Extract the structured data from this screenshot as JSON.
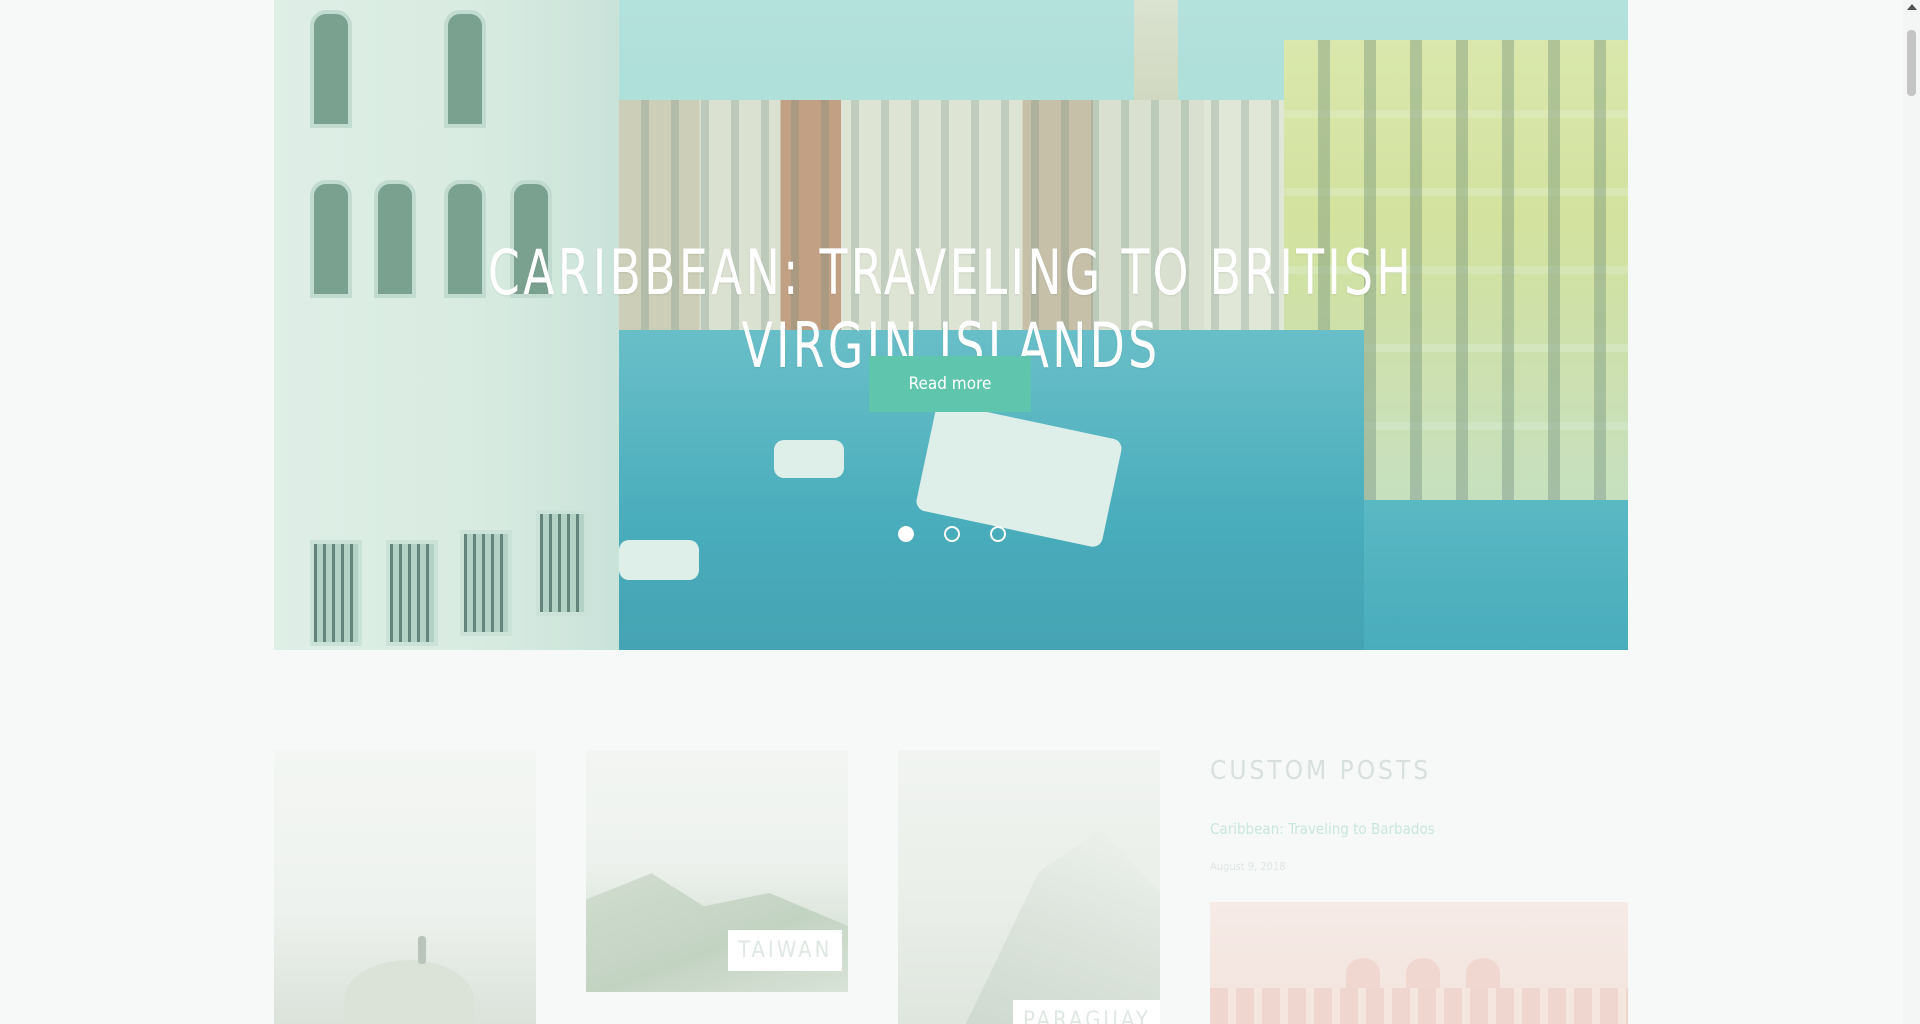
{
  "hero": {
    "title": "CARIBBEAN: TRAVELING TO BRITISH VIRGIN ISLANDS",
    "button_label": "Read more",
    "slides": 3,
    "active_slide": 1
  },
  "cards": [
    {
      "label": ""
    },
    {
      "label": "TAIWAN"
    },
    {
      "label": "PARAGUAY"
    }
  ],
  "sidebar": {
    "title": "CUSTOM POSTS",
    "post": {
      "title": "Caribbean: Traveling to Barbados",
      "date": "August 9, 2018"
    }
  },
  "colors": {
    "accent": "#5fc5ad",
    "hero_text": "#ffffff",
    "background": "#f7f9f8"
  },
  "icons": [
    "scroll-up-arrow-icon"
  ]
}
